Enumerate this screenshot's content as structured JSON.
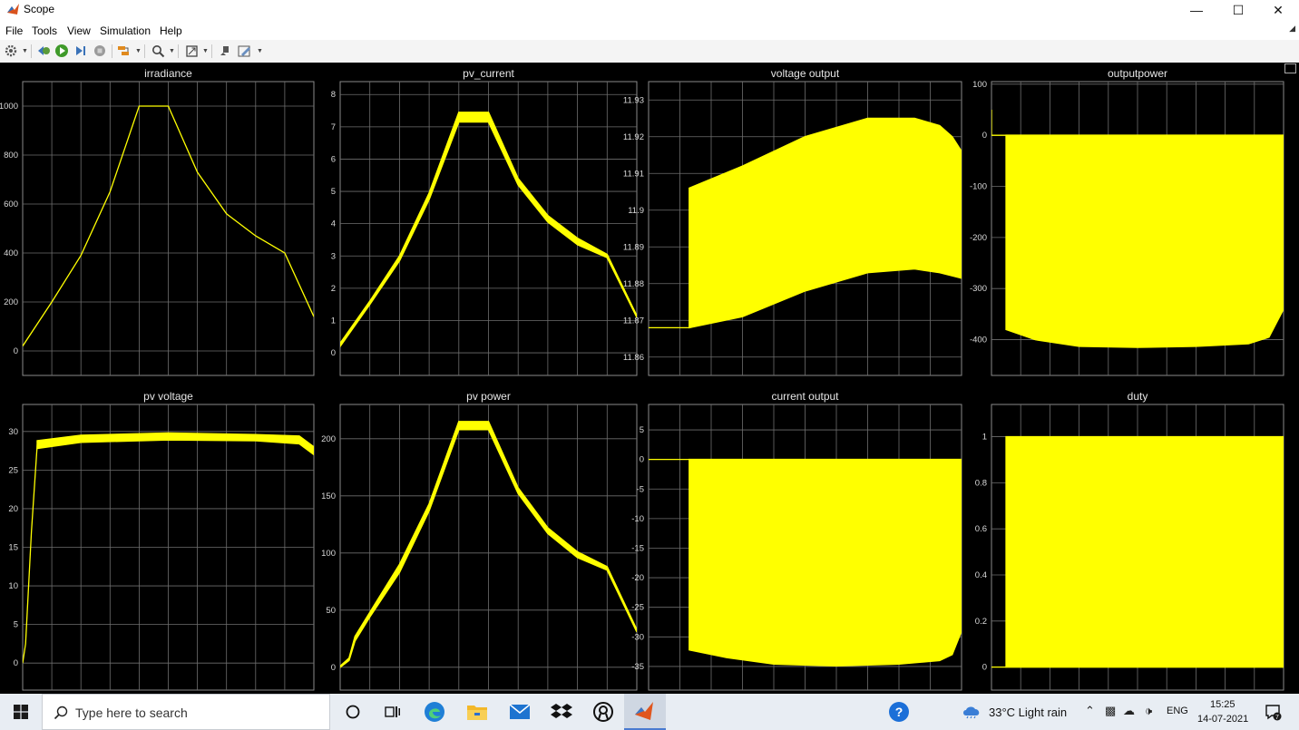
{
  "window": {
    "title": "Scope",
    "minimize_glyph": "—",
    "maximize_glyph": "☐",
    "close_glyph": "✕"
  },
  "menu": {
    "items": [
      "File",
      "Tools",
      "View",
      "Simulation",
      "Help"
    ]
  },
  "toolbar": {
    "icons": [
      "gear-icon",
      "step-back-icon",
      "run-icon",
      "step-forward-icon",
      "stop-icon",
      "highlight-block-icon",
      "zoom-icon",
      "autoscale-icon",
      "write-tool-icon",
      "edit-style-icon"
    ]
  },
  "colors": {
    "signal": "#ffff00",
    "grid": "#6e6e6e",
    "axes_bg": "#000000",
    "tick_text": "#d9d9d9",
    "title_text": "#e6e6e6"
  },
  "chart_data": [
    {
      "type": "line",
      "title": "irradiance",
      "ylim": [
        -100,
        1100
      ],
      "yticks": [
        0,
        200,
        400,
        600,
        800,
        1000
      ],
      "grid": true,
      "series": [
        {
          "values": [
            [
              0,
              20
            ],
            [
              0.1,
              200
            ],
            [
              0.2,
              390
            ],
            [
              0.3,
              650
            ],
            [
              0.4,
              1000
            ],
            [
              0.5,
              1000
            ],
            [
              0.6,
              730
            ],
            [
              0.7,
              560
            ],
            [
              0.8,
              470
            ],
            [
              0.9,
              400
            ],
            [
              1,
              140
            ]
          ]
        }
      ]
    },
    {
      "type": "line",
      "title": "pv_current",
      "ylim": [
        -0.7,
        8.4
      ],
      "yticks": [
        0,
        1,
        2,
        3,
        4,
        5,
        6,
        7,
        8
      ],
      "grid": true,
      "series": [
        {
          "band": true,
          "upper": [
            [
              0,
              0.3
            ],
            [
              0.1,
              1.6
            ],
            [
              0.2,
              3.0
            ],
            [
              0.3,
              4.95
            ],
            [
              0.4,
              7.45
            ],
            [
              0.5,
              7.45
            ],
            [
              0.6,
              5.4
            ],
            [
              0.7,
              4.25
            ],
            [
              0.8,
              3.55
            ],
            [
              0.9,
              3.05
            ],
            [
              1,
              1.15
            ]
          ],
          "lower": [
            [
              0,
              0.2
            ],
            [
              0.1,
              1.5
            ],
            [
              0.2,
              2.85
            ],
            [
              0.3,
              4.75
            ],
            [
              0.4,
              7.15
            ],
            [
              0.5,
              7.15
            ],
            [
              0.6,
              5.2
            ],
            [
              0.7,
              4.05
            ],
            [
              0.8,
              3.35
            ],
            [
              0.9,
              2.95
            ],
            [
              1,
              1.1
            ]
          ]
        }
      ]
    },
    {
      "type": "line",
      "title": "voltage output",
      "ylim": [
        11.855,
        11.935
      ],
      "yticks": [
        11.86,
        11.87,
        11.88,
        11.89,
        11.9,
        11.91,
        11.92,
        11.93
      ],
      "grid": true,
      "series": [
        {
          "band": true,
          "upper": [
            [
              0.13,
              11.906
            ],
            [
              0.3,
              11.912
            ],
            [
              0.5,
              11.92
            ],
            [
              0.7,
              11.925
            ],
            [
              0.85,
              11.925
            ],
            [
              0.93,
              11.923
            ],
            [
              0.97,
              11.92
            ],
            [
              1,
              11.916
            ]
          ],
          "lower": [
            [
              0.13,
              11.868
            ],
            [
              0.3,
              11.871
            ],
            [
              0.5,
              11.878
            ],
            [
              0.7,
              11.883
            ],
            [
              0.85,
              11.884
            ],
            [
              0.93,
              11.883
            ],
            [
              1,
              11.8815
            ]
          ],
          "lead": [
            [
              0,
              11.868
            ],
            [
              0.13,
              11.868
            ]
          ]
        }
      ]
    },
    {
      "type": "line",
      "title": "outputpower",
      "ylim": [
        -470,
        105
      ],
      "yticks": [
        -400,
        -300,
        -200,
        -100,
        0,
        100
      ],
      "grid": true,
      "series": [
        {
          "band": true,
          "upper": [
            [
              0.05,
              0
            ],
            [
              1,
              0
            ]
          ],
          "lower": [
            [
              0.05,
              -380
            ],
            [
              0.15,
              -400
            ],
            [
              0.3,
              -413
            ],
            [
              0.5,
              -415
            ],
            [
              0.7,
              -413
            ],
            [
              0.88,
              -408
            ],
            [
              0.95,
              -395
            ],
            [
              1,
              -340
            ]
          ],
          "lead": [
            [
              0,
              50
            ],
            [
              0,
              0
            ],
            [
              0.05,
              0
            ]
          ]
        }
      ]
    },
    {
      "type": "line",
      "title": "pv voltage",
      "ylim": [
        -3.5,
        33.5
      ],
      "yticks": [
        0,
        5,
        10,
        15,
        20,
        25,
        30
      ],
      "grid": true,
      "series": [
        {
          "band": true,
          "upper": [
            [
              0.05,
              28.8
            ],
            [
              0.2,
              29.5
            ],
            [
              0.5,
              29.8
            ],
            [
              0.8,
              29.6
            ],
            [
              0.95,
              29.4
            ],
            [
              1,
              28.0
            ]
          ],
          "lower": [
            [
              0.05,
              27.8
            ],
            [
              0.2,
              28.6
            ],
            [
              0.5,
              28.9
            ],
            [
              0.8,
              28.8
            ],
            [
              0.95,
              28.4
            ],
            [
              1,
              27.0
            ]
          ],
          "lead": [
            [
              0,
              0
            ],
            [
              0.01,
              2.5
            ],
            [
              0.03,
              17
            ],
            [
              0.05,
              28.3
            ]
          ]
        }
      ]
    },
    {
      "type": "line",
      "title": "pv power",
      "ylim": [
        -20,
        230
      ],
      "yticks": [
        0,
        50,
        100,
        150,
        200
      ],
      "grid": true,
      "series": [
        {
          "band": true,
          "upper": [
            [
              0,
              1
            ],
            [
              0.03,
              8
            ],
            [
              0.05,
              27
            ],
            [
              0.1,
              48
            ],
            [
              0.2,
              90
            ],
            [
              0.3,
              143
            ],
            [
              0.4,
              215
            ],
            [
              0.5,
              215
            ],
            [
              0.6,
              157
            ],
            [
              0.7,
              122
            ],
            [
              0.8,
              101
            ],
            [
              0.9,
              88
            ],
            [
              1,
              33
            ]
          ],
          "lower": [
            [
              0,
              0
            ],
            [
              0.03,
              6
            ],
            [
              0.05,
              23
            ],
            [
              0.1,
              44
            ],
            [
              0.2,
              83
            ],
            [
              0.3,
              137
            ],
            [
              0.4,
              208
            ],
            [
              0.5,
              208
            ],
            [
              0.6,
              152
            ],
            [
              0.7,
              117
            ],
            [
              0.8,
              96
            ],
            [
              0.9,
              85
            ],
            [
              1,
              31
            ]
          ]
        }
      ]
    },
    {
      "type": "line",
      "title": "current output",
      "ylim": [
        -39,
        9.3
      ],
      "yticks": [
        -35,
        -30,
        -25,
        -20,
        -15,
        -10,
        -5,
        0,
        5
      ],
      "grid": true,
      "series": [
        {
          "band": true,
          "upper": [
            [
              0.13,
              0
            ],
            [
              1,
              0
            ]
          ],
          "lower": [
            [
              0.13,
              -32.2
            ],
            [
              0.25,
              -33.5
            ],
            [
              0.4,
              -34.6
            ],
            [
              0.6,
              -34.9
            ],
            [
              0.8,
              -34.6
            ],
            [
              0.93,
              -34.0
            ],
            [
              0.97,
              -33.0
            ],
            [
              1,
              -29.0
            ]
          ],
          "lead": [
            [
              0,
              0
            ],
            [
              0.13,
              0
            ]
          ]
        }
      ]
    },
    {
      "type": "line",
      "title": "duty",
      "ylim": [
        -0.1,
        1.14
      ],
      "yticks": [
        0,
        0.2,
        0.4,
        0.6,
        0.8,
        1
      ],
      "grid": true,
      "series": [
        {
          "band": true,
          "upper": [
            [
              0.05,
              1
            ],
            [
              1,
              1
            ]
          ],
          "lower": [
            [
              0.05,
              0
            ],
            [
              1,
              0
            ]
          ],
          "lead": [
            [
              0,
              0
            ],
            [
              0.05,
              0
            ]
          ]
        }
      ]
    }
  ],
  "taskbar": {
    "search_placeholder": "Type here to search",
    "weather": "33°C  Light rain",
    "language": "ENG",
    "time": "15:25",
    "date": "14-07-2021",
    "notification_count": "7",
    "help_label": "?"
  }
}
